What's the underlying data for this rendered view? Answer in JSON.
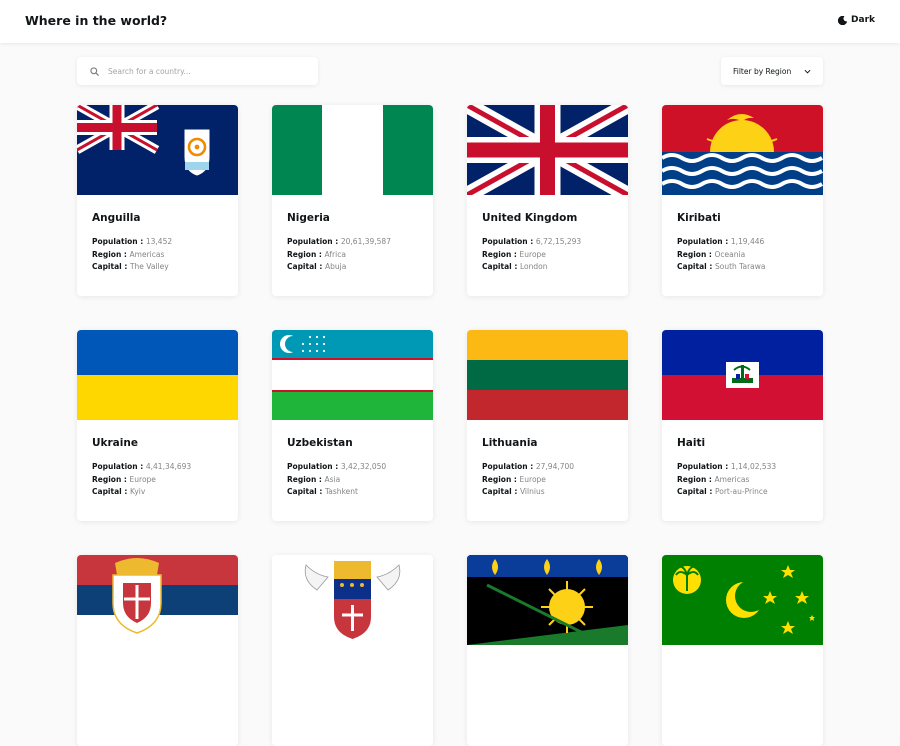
{
  "header": {
    "title": "Where in the world?",
    "theme_label": "Dark"
  },
  "search": {
    "placeholder": "Search for a country..."
  },
  "filter": {
    "label": "Filter by Region"
  },
  "labels": {
    "population": "Population",
    "region": "Region",
    "capital": "Capital",
    "sep": " : "
  },
  "countries": [
    {
      "name": "Anguilla",
      "population": "13,452",
      "region": "Americas",
      "capital": "The Valley"
    },
    {
      "name": "Nigeria",
      "population": "20,61,39,587",
      "region": "Africa",
      "capital": "Abuja"
    },
    {
      "name": "United Kingdom",
      "population": "6,72,15,293",
      "region": "Europe",
      "capital": "London"
    },
    {
      "name": "Kiribati",
      "population": "1,19,446",
      "region": "Oceania",
      "capital": "South Tarawa"
    },
    {
      "name": "Ukraine",
      "population": "4,41,34,693",
      "region": "Europe",
      "capital": "Kyiv"
    },
    {
      "name": "Uzbekistan",
      "population": "3,42,32,050",
      "region": "Asia",
      "capital": "Tashkent"
    },
    {
      "name": "Lithuania",
      "population": "27,94,700",
      "region": "Europe",
      "capital": "Vilnius"
    },
    {
      "name": "Haiti",
      "population": "1,14,02,533",
      "region": "Americas",
      "capital": "Port-au-Prince"
    }
  ],
  "colors": {
    "background": "#fafafa",
    "card": "#ffffff",
    "text": "#111517",
    "muted": "#858585"
  },
  "icons": [
    "moon-icon",
    "search-icon",
    "chevron-down-icon"
  ]
}
